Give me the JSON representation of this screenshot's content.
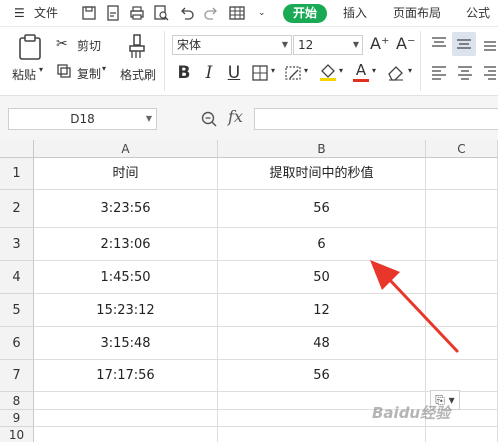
{
  "menu": {
    "hamburger_label": "文件",
    "tabs": [
      "开始",
      "插入",
      "页面布局",
      "公式"
    ]
  },
  "ribbon": {
    "paste_label": "粘贴",
    "cut_label": "剪切",
    "copy_label": "复制",
    "format_painter_label": "格式刷",
    "font_name": "宋体",
    "font_size": "12",
    "bold": "B",
    "italic": "I",
    "underline": "U",
    "font_color_letter": "A",
    "font_color": "#e0301e",
    "highlight_color": "#f5d500",
    "grow_font": "A⁺",
    "shrink_font": "A⁻"
  },
  "formula_bar": {
    "name_box": "D18",
    "fx": "fx",
    "content": ""
  },
  "sheet": {
    "columns": [
      "A",
      "B",
      "C"
    ],
    "rows": [
      {
        "num": "1",
        "a": "时间",
        "b": "提取时间中的秒值"
      },
      {
        "num": "2",
        "a": "3:23:56",
        "b": "56"
      },
      {
        "num": "3",
        "a": "2:13:06",
        "b": "6"
      },
      {
        "num": "4",
        "a": "1:45:50",
        "b": "50"
      },
      {
        "num": "5",
        "a": "15:23:12",
        "b": "12"
      },
      {
        "num": "6",
        "a": "3:15:48",
        "b": "48"
      },
      {
        "num": "7",
        "a": "17:17:56",
        "b": "56"
      },
      {
        "num": "8",
        "a": "",
        "b": ""
      },
      {
        "num": "9",
        "a": "",
        "b": ""
      },
      {
        "num": "10",
        "a": "",
        "b": ""
      }
    ],
    "annotation_arrow_color": "#e8362a"
  },
  "watermark": "Baidu经验"
}
